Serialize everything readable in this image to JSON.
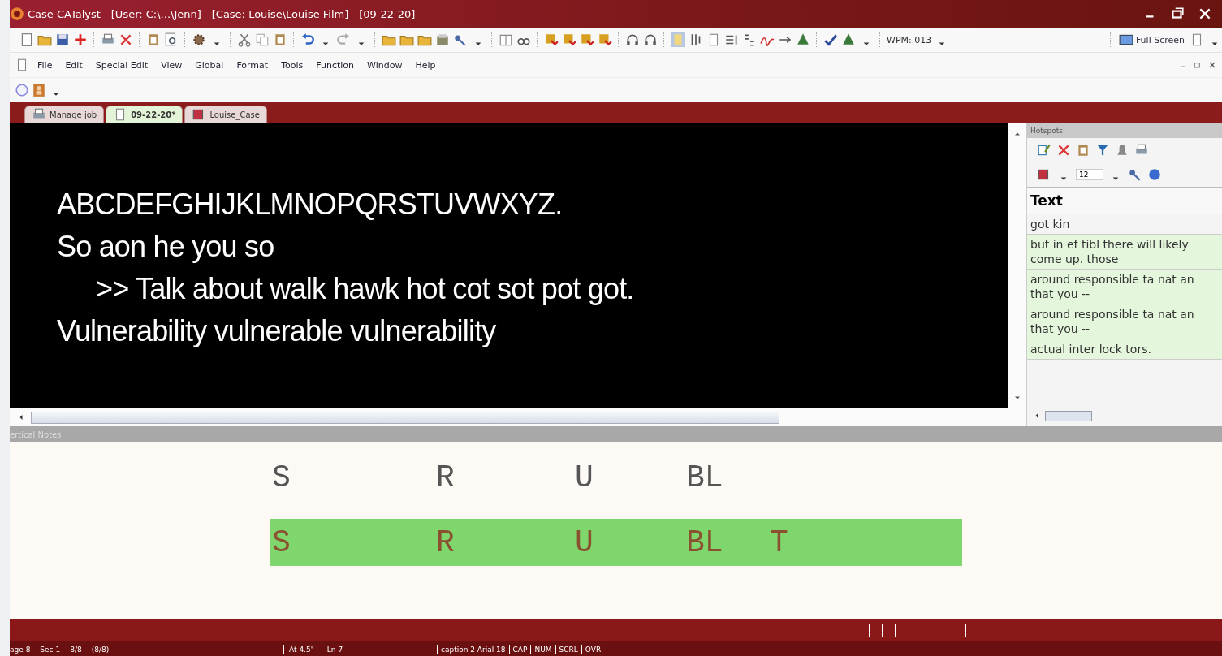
{
  "window": {
    "title": "Case CATalyst - [User: C:\\...\\Jenn] - [Case: Louise\\Louise Film] - [09-22-20]"
  },
  "toolbar": {
    "wpm": "WPM: 013",
    "full_screen": "Full Screen"
  },
  "menu": [
    "File",
    "Edit",
    "Special Edit",
    "View",
    "Global",
    "Format",
    "Tools",
    "Function",
    "Window",
    "Help"
  ],
  "tabs": [
    {
      "label": "Manage job",
      "selected": false
    },
    {
      "label": "09-22-20*",
      "selected": true
    },
    {
      "label": "Louise_Case",
      "selected": false
    }
  ],
  "editor": {
    "lines": [
      {
        "text": "ABCDEFGHIJKLMNOPQRSTUVWXYZ.",
        "indented": false
      },
      {
        "text": "So aon he you so",
        "indented": false
      },
      {
        "text": ">> Talk about walk hawk hot cot sot pot got.",
        "indented": true
      },
      {
        "text": "Vulnerability vulnerable vulnerability",
        "indented": false
      }
    ]
  },
  "hotspots": {
    "title": "Hotspots",
    "font_size": "12",
    "column": "Text",
    "rows": [
      {
        "lines": [
          "got kin"
        ],
        "highlighted": false
      },
      {
        "lines": [
          "but in ef tibl there will likely",
          "come up. those"
        ],
        "highlighted": true
      },
      {
        "lines": [
          "around responsible ta nat an",
          "that you --"
        ],
        "highlighted": true
      },
      {
        "lines": [
          "around responsible ta nat an",
          "that you --"
        ],
        "highlighted": true
      },
      {
        "lines": [
          "actual inter lock tors."
        ],
        "highlighted": true
      }
    ]
  },
  "notes": {
    "title": "ertical Notes",
    "rows": [
      {
        "keys": [
          "S",
          "R",
          "U",
          "BL"
        ],
        "highlighted": false
      },
      {
        "keys": [
          "S",
          "R",
          "U",
          "BL",
          "T"
        ],
        "highlighted": true
      }
    ]
  },
  "status_bar": {
    "left": [
      "age 8",
      "Sec 1",
      "8/8",
      "(8/8)"
    ],
    "middle": [
      "At 4.5\"",
      "Ln 7"
    ],
    "right": [
      "caption 2 Arial 18",
      "CAP",
      "NUM",
      "SCRL",
      "OVR"
    ]
  }
}
